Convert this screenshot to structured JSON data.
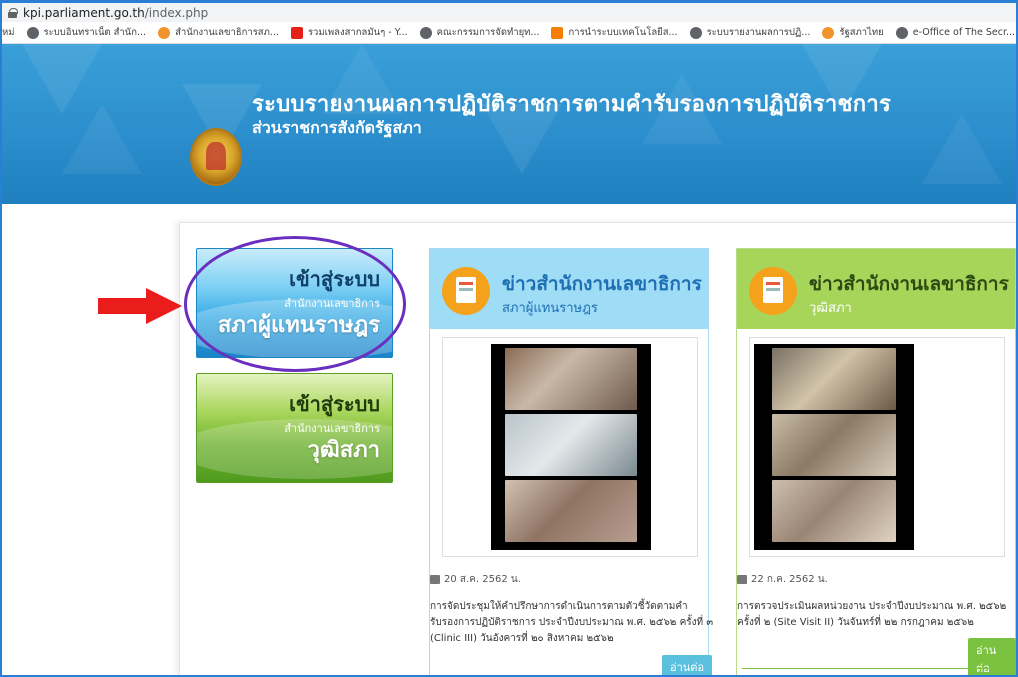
{
  "browser": {
    "url_host": "kpi.parliament.go.th",
    "url_path": "/index.php",
    "bookmarks": [
      {
        "label": "หม่",
        "icon": "none"
      },
      {
        "label": "ระบบอินทราเน็ต สำนัก...",
        "icon": "globe-icon"
      },
      {
        "label": "สำนักงานเลขาธิการสภ...",
        "icon": "orange-circle-icon"
      },
      {
        "label": "รวมเพลงสากลมันๆ - Y...",
        "icon": "youtube-icon"
      },
      {
        "label": "คณะกรรมการจัดทำยุท...",
        "icon": "globe-icon"
      },
      {
        "label": "การนำระบบเทคโนโลยีส...",
        "icon": "blogger-icon"
      },
      {
        "label": "ระบบรายงานผลการปฏิ...",
        "icon": "globe-icon"
      },
      {
        "label": "รัฐสภาไทย",
        "icon": "orange-circle-icon"
      },
      {
        "label": "e-Office of The Secr...",
        "icon": "globe-icon"
      }
    ]
  },
  "header": {
    "title": "ระบบรายงานผลการปฏิบัติราชการตามคำรับรองการปฏิบัติราชการ",
    "subtitle": "ส่วนราชการสังกัดรัฐสภา"
  },
  "systems": {
    "hor": {
      "line1": "เข้าสู่ระบบ",
      "line2": "สำนักงานเลขาธิการ",
      "line3": "สภาผู้แทนราษฎร"
    },
    "senate": {
      "line1": "เข้าสู่ระบบ",
      "line2": "สำนักงานเลขาธิการ",
      "line3": "วุฒิสภา"
    }
  },
  "news": {
    "hor": {
      "title": "ข่าวสำนักงานเลขาธิการ",
      "subtitle": "สภาผู้แทนราษฎร",
      "date": "20 ส.ค. 2562 น.",
      "description": "การจัดประชุมให้คำปรึกษาการดำเนินการตามตัวชี้วัดตามคำรับรองการปฏิบัติราชการ ประจำปีงบประมาณ พ.ศ. ๒๕๖๒ ครั้งที่ ๓ (Clinic III) วันอังคารที่ ๒๐ สิงหาคม ๒๕๖๒",
      "more_label": "อ่านต่อ"
    },
    "senate": {
      "title": "ข่าวสำนักงานเลขาธิการ",
      "subtitle": "วุฒิสภา",
      "date": "22 ก.ค. 2562 น.",
      "description": "การตรวจประเมินผลหน่วยงาน ประจำปีงบประมาณ พ.ศ. ๒๕๖๒ ครั้งที่ ๒ (Site Visit II) วันจันทร์ที่ ๒๒ กรกฎาคม ๒๕๖๒",
      "more_label": "อ่านต่อ"
    }
  },
  "colors": {
    "header_blue": "#2b8dcc",
    "annotation_circle": "#6a2fbe",
    "annotation_arrow": "#ea1c1c",
    "hor_accent": "#5bc0de",
    "senate_accent": "#7cc241"
  }
}
